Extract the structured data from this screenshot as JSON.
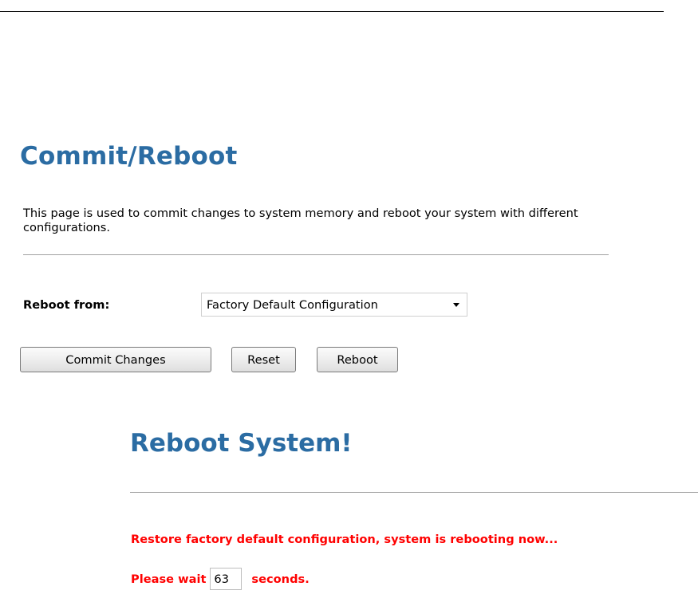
{
  "header": {
    "title": "Commit/Reboot",
    "description": "This page is used to commit changes to system memory and reboot your system with different configurations."
  },
  "form": {
    "reboot_from_label": "Reboot from:",
    "reboot_from_selected": "Factory Default Configuration",
    "buttons": {
      "commit": "Commit Changes",
      "reset": "Reset",
      "reboot": "Reboot"
    }
  },
  "reboot_panel": {
    "title": "Reboot System!",
    "message": "Restore factory default configuration, system is rebooting now...",
    "wait_prefix": "Please wait",
    "countdown_value": "63",
    "wait_suffix": "seconds."
  },
  "colors": {
    "heading": "#2b6ca3",
    "alert": "#ff0000"
  }
}
